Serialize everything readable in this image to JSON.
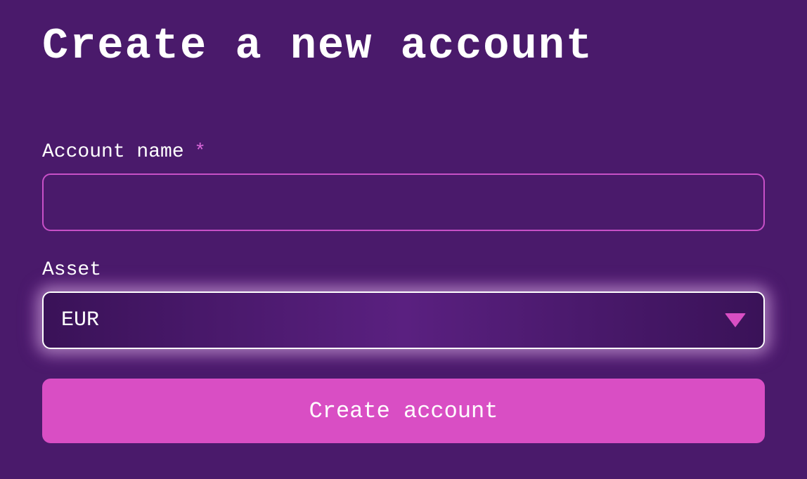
{
  "page": {
    "title": "Create a new account"
  },
  "form": {
    "account_name": {
      "label": "Account name",
      "required_marker": "*",
      "value": ""
    },
    "asset": {
      "label": "Asset",
      "selected_value": "EUR"
    },
    "submit_label": "Create account"
  }
}
